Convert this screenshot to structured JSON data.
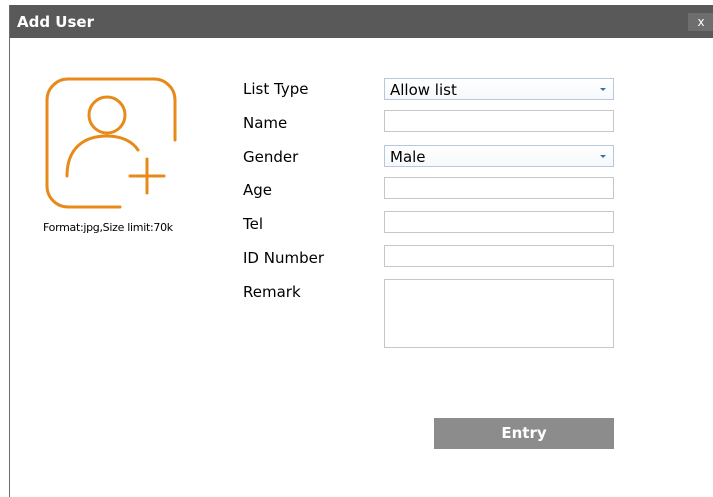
{
  "window": {
    "title": "Add User",
    "close_label": "x"
  },
  "avatar": {
    "icon": "add-user-photo-icon",
    "accent_color": "#E88A1A",
    "format_note": "Format:jpg,Size limit:70k"
  },
  "form": {
    "list_type": {
      "label": "List Type",
      "value": "Allow list"
    },
    "name": {
      "label": "Name",
      "value": ""
    },
    "gender": {
      "label": "Gender",
      "value": "Male"
    },
    "age": {
      "label": "Age",
      "value": ""
    },
    "tel": {
      "label": "Tel",
      "value": ""
    },
    "id_number": {
      "label": "ID Number",
      "value": ""
    },
    "remark": {
      "label": "Remark",
      "value": ""
    }
  },
  "actions": {
    "entry_label": "Entry"
  },
  "colors": {
    "titlebar": "#595959",
    "button": "#8C8C8C"
  }
}
